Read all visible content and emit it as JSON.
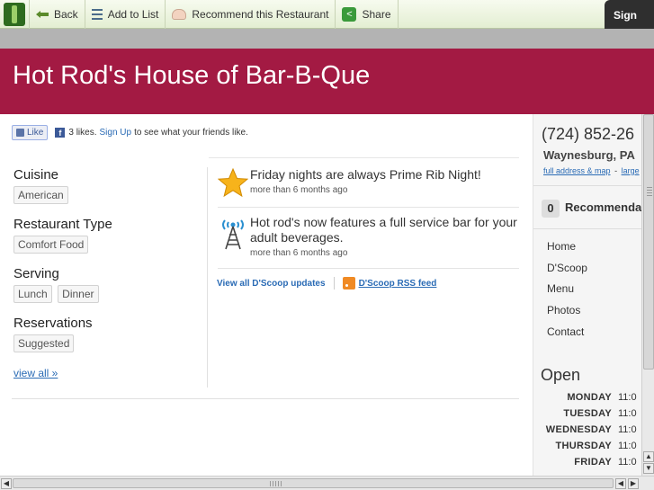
{
  "toolbar": {
    "back_label": "Back",
    "add_to_list_label": "Add to List",
    "recommend_label": "Recommend this Restaurant",
    "share_label": "Share",
    "signin_label": "Sign"
  },
  "restaurant": {
    "name": "Hot Rod's House of Bar-B-Que"
  },
  "social": {
    "like_button": "Like",
    "likes_text": "3 likes.",
    "signup_link": "Sign Up",
    "friends_text": "to see what your friends like."
  },
  "facets": [
    {
      "heading": "Cuisine",
      "tags": [
        "American"
      ]
    },
    {
      "heading": "Restaurant Type",
      "tags": [
        "Comfort Food"
      ]
    },
    {
      "heading": "Serving",
      "tags": [
        "Lunch",
        "Dinner"
      ]
    },
    {
      "heading": "Reservations",
      "tags": [
        "Suggested"
      ]
    }
  ],
  "view_all": "view all »",
  "scoops": [
    {
      "icon": "star-icon",
      "text": "Friday nights are always Prime Rib Night!",
      "ago": "more than 6 months ago"
    },
    {
      "icon": "broadcast-tower-icon",
      "text": "Hot rod's now features a full service bar for your adult beverages.",
      "ago": "more than 6 months ago"
    }
  ],
  "scoop_links": {
    "view_all_updates": "View all D'Scoop updates",
    "rss_feed": "D'Scoop RSS feed"
  },
  "sidebar": {
    "phone": "(724) 852-26",
    "city": "Waynesburg, PA",
    "full_address": "full address & map",
    "separator": "-",
    "larger": "large",
    "recommend_count": "0",
    "recommend_label": "Recommenda",
    "nav": [
      "Home",
      "D'Scoop",
      "Menu",
      "Photos",
      "Contact"
    ],
    "open_heading": "Open",
    "hours": [
      {
        "day": "MONDAY",
        "time": "11:0"
      },
      {
        "day": "TUESDAY",
        "time": "11:0"
      },
      {
        "day": "WEDNESDAY",
        "time": "11:0"
      },
      {
        "day": "THURSDAY",
        "time": "11:0"
      },
      {
        "day": "FRIDAY",
        "time": "11:0"
      }
    ]
  },
  "scrollbar": {
    "arrow_up": "▲",
    "arrow_down": "▼",
    "arrow_left": "◀",
    "arrow_right": "▶"
  }
}
